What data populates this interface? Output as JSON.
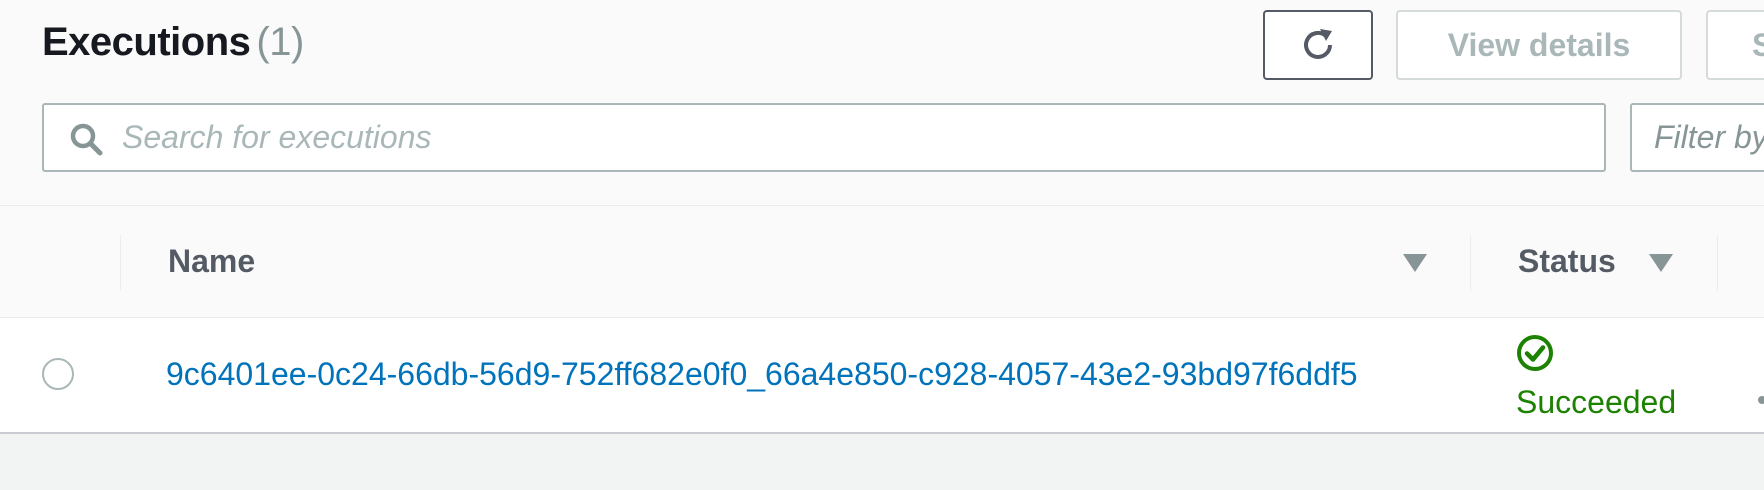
{
  "header": {
    "title": "Executions",
    "count": "(1)",
    "view_details_label": "View details",
    "third_button_label": "S"
  },
  "search": {
    "placeholder": "Search for executions",
    "value": ""
  },
  "filter": {
    "label": "Filter by"
  },
  "table": {
    "columns": [
      {
        "label": "Name",
        "sort": "descending"
      },
      {
        "label": "Status",
        "sort": "descending"
      }
    ],
    "rows": [
      {
        "selected": false,
        "name": "9c6401ee-0c24-66db-56d9-752ff682e0f0_66a4e850-c928-4057-43e2-93bd97f6ddf5",
        "status": "Succeeded",
        "status_icon": "check-circle-icon"
      }
    ]
  },
  "colors": {
    "link": "#0073bb",
    "success": "#1d8102",
    "disabled_text": "#aab7b8",
    "heading": "#16191f"
  }
}
